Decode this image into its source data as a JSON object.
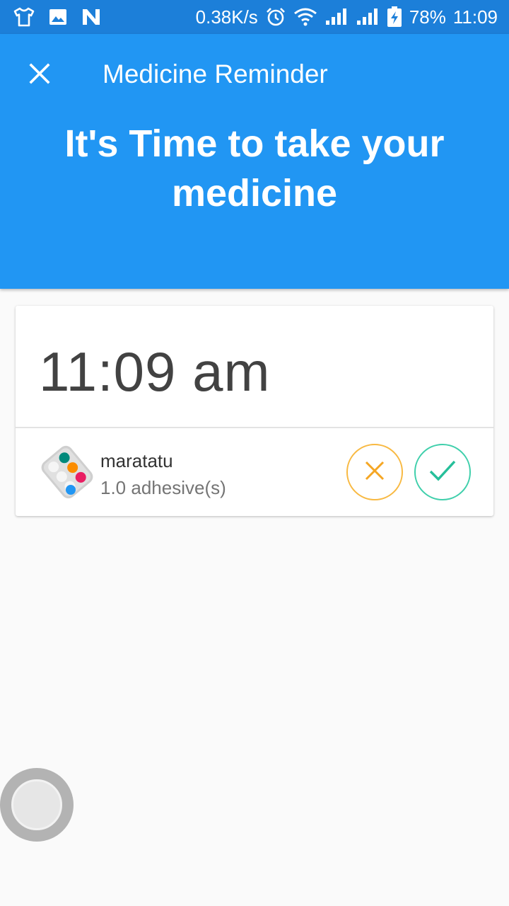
{
  "status_bar": {
    "net_speed": "0.38K/s",
    "battery": "78%",
    "time": "11:09",
    "icons": [
      "shirt-icon",
      "image-icon",
      "n-icon",
      "alarm-icon",
      "wifi-icon",
      "signal-icon",
      "signal-icon",
      "battery-charging-icon"
    ]
  },
  "app_bar": {
    "title": "Medicine Reminder",
    "headline_line1": "It's Time to take your",
    "headline_line2": "medicine",
    "color": "#2196f3"
  },
  "reminder_card": {
    "time": "11:09 am",
    "medicine": {
      "name": "maratatu",
      "dose": "1.0 adhesive(s)",
      "icon": "pill-blister-icon"
    },
    "skip_color": "#f8b942",
    "take_color": "#3fcfab"
  }
}
